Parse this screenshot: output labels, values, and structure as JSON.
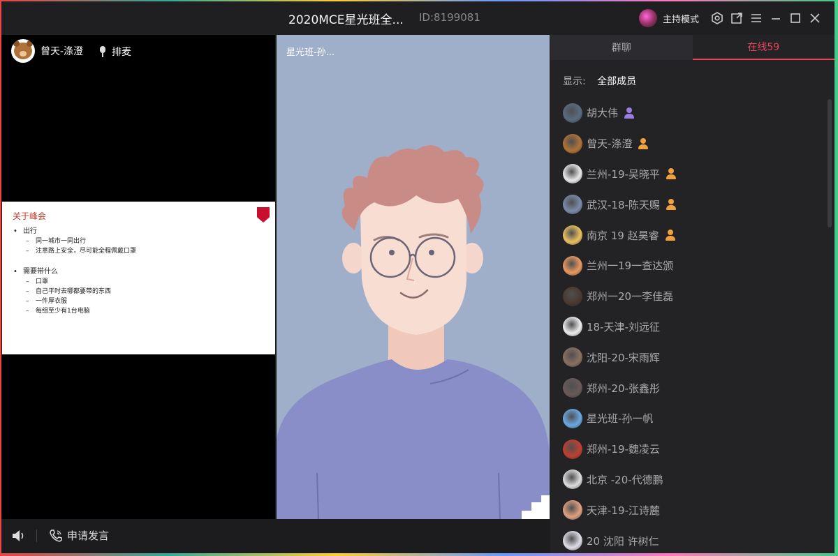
{
  "window": {
    "title": "2020MCE星光班全...",
    "room_id": "ID:8199081",
    "host_mode_label": "主持模式",
    "controls": [
      "settings-icon",
      "popout-icon",
      "menu-icon",
      "minimize-icon",
      "maximize-icon",
      "close-icon"
    ]
  },
  "left_panel": {
    "speaker_name": "曾天-涤澄",
    "mic_queue_label": "排麦",
    "slide": {
      "title": "关于峰会",
      "items": [
        {
          "label": "出行",
          "subs": [
            "同一城市一同出行",
            "注意路上安全，尽可能全程佩戴口罩"
          ]
        },
        {
          "label": "需要带什么",
          "subs": [
            "口罩",
            "自己平时去哪都要带的东西",
            "一件厚衣服",
            "每组至少有1台电脑"
          ]
        }
      ]
    }
  },
  "center_video": {
    "label": "星光班-孙..."
  },
  "bottom_bar": {
    "apply_speak_label": "申请发言"
  },
  "right_panel": {
    "tabs": {
      "group_chat": "群聊",
      "online": "在线59"
    },
    "filter": {
      "label": "显示:",
      "value": "全部成员"
    },
    "members": [
      {
        "name": "胡大伟",
        "role_color": "#9b7de0",
        "avatar_color": "#5a6b80"
      },
      {
        "name": "曾天-涤澄",
        "role_color": "#f0a03c",
        "avatar_color": "#b07238"
      },
      {
        "name": "兰州-19-吴晓平",
        "role_color": "#f0a03c",
        "avatar_color": "#e8e8e8"
      },
      {
        "name": "武汉-18-陈天赐",
        "role_color": "#f0a03c",
        "avatar_color": "#7a8aa8"
      },
      {
        "name": "南京 19 赵昊睿",
        "role_color": "#f0a03c",
        "avatar_color": "#e8c060"
      },
      {
        "name": "兰州一19一查达颁",
        "role_color": "",
        "avatar_color": "#e89860"
      },
      {
        "name": "郑州一20一李佳磊",
        "role_color": "",
        "avatar_color": "#4a3a30"
      },
      {
        "name": "18-天津-刘远征",
        "role_color": "",
        "avatar_color": "#eeeeee"
      },
      {
        "name": "沈阳-20-宋雨辉",
        "role_color": "",
        "avatar_color": "#8a7060"
      },
      {
        "name": "郑州-20-张鑫彤",
        "role_color": "",
        "avatar_color": "#6a5a58"
      },
      {
        "name": "星光班-孙一帆",
        "role_color": "",
        "avatar_color": "#6aa8e0"
      },
      {
        "name": "郑州-19-魏凌云",
        "role_color": "",
        "avatar_color": "#c04030"
      },
      {
        "name": "北京 -20-代德鹏",
        "role_color": "",
        "avatar_color": "#dddddd"
      },
      {
        "name": "天津-19-江诗麓",
        "role_color": "",
        "avatar_color": "#e0a080"
      },
      {
        "name": "20 沈阳 许树仁",
        "role_color": "",
        "avatar_color": "#e0dde8"
      }
    ]
  }
}
